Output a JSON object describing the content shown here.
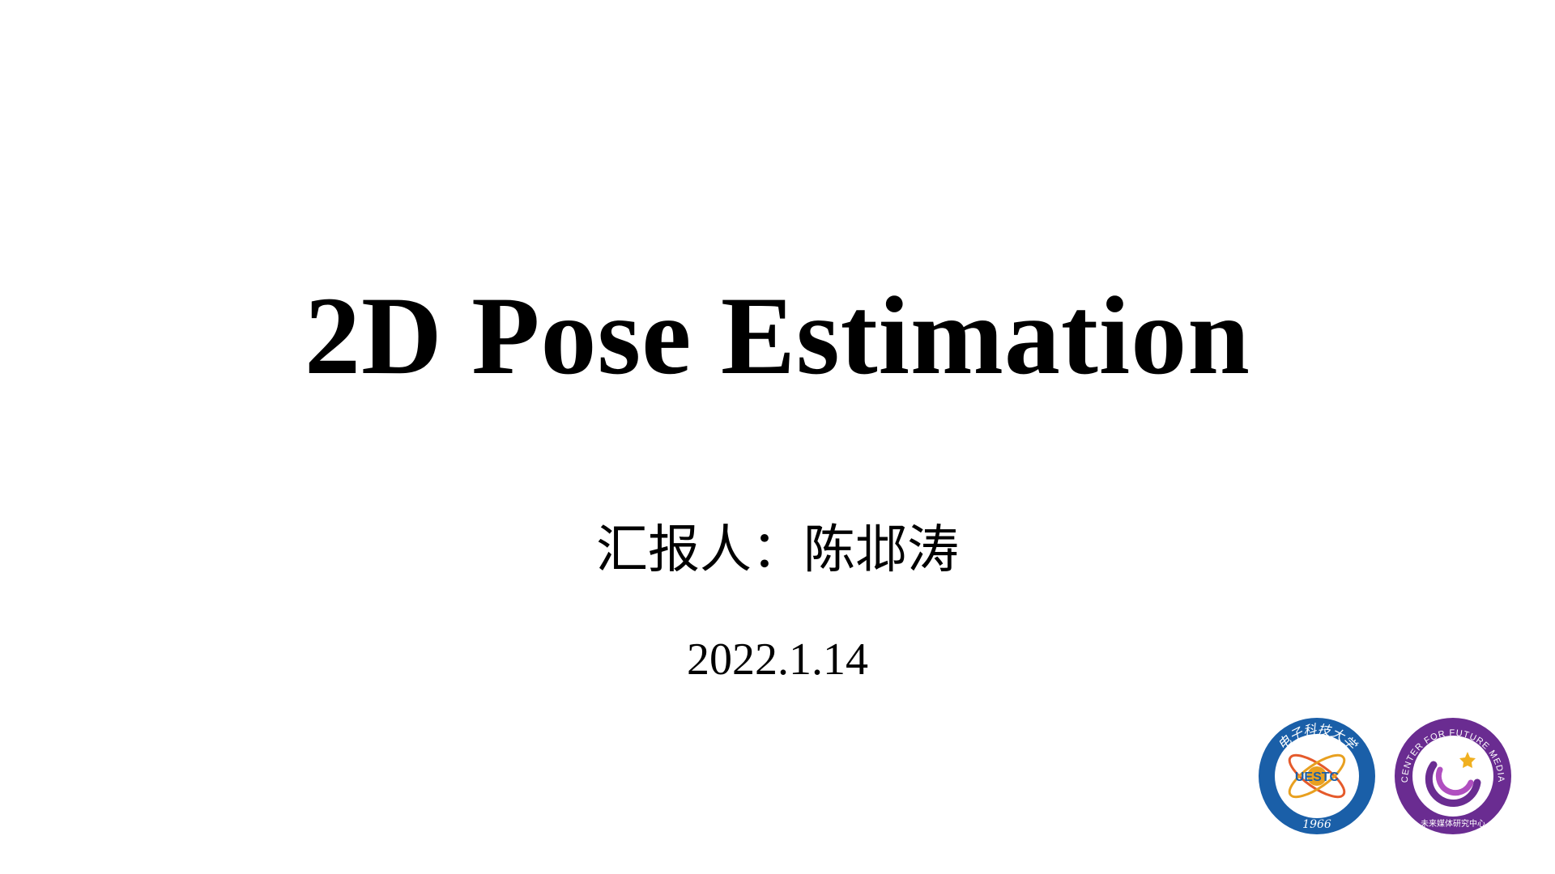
{
  "slide": {
    "title": "2D Pose Estimation",
    "presenter_line": "汇报人：陈邶涛",
    "date": "2022.1.14"
  },
  "logos": {
    "uestc": {
      "center_text": "UESTC",
      "year": "1966",
      "top_text": "电子科技大学",
      "colors": {
        "ring": "#1a5fa8",
        "accent": "#e8a020",
        "orbit": "#e55a2b"
      }
    },
    "cfm": {
      "ring_text": "CENTER FOR FUTURE MEDIA",
      "bottom_text": "未来媒体研究中心",
      "colors": {
        "ring": "#6a2c91",
        "accent": "#f0b020"
      }
    }
  }
}
